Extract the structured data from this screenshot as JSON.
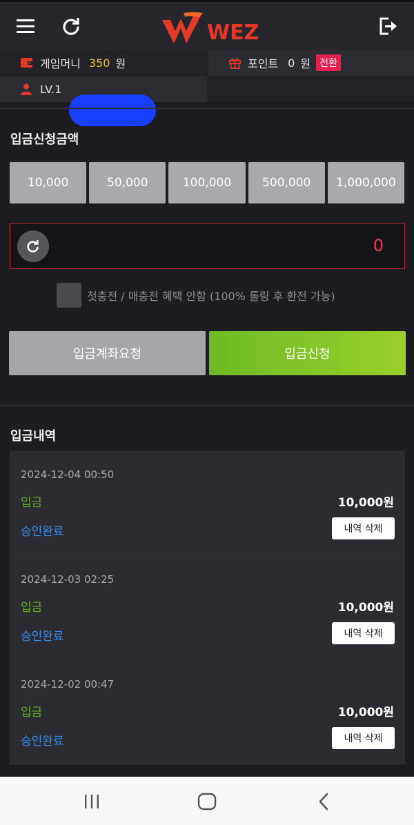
{
  "header": {
    "logo_text": "WEZ",
    "icons": [
      "menu-icon",
      "refresh-icon",
      "logout-icon"
    ]
  },
  "info": {
    "game_money_label": "게임머니",
    "game_money_value": "350",
    "game_money_unit": "원",
    "point_label": "포인트",
    "point_value": "0",
    "point_unit": "원",
    "convert_label": "전환",
    "level_label": "LV.1"
  },
  "deposit": {
    "section_title": "입금신청금액",
    "amounts": [
      "10,000",
      "50,000",
      "100,000",
      "500,000",
      "1,000,000"
    ],
    "amount_value": "0",
    "checkbox_label": "첫충전 / 매충전 혜택 안함 (100% 롤링 후 환전 가능)",
    "account_request_label": "입금계좌요청",
    "apply_label": "입금신청"
  },
  "history": {
    "section_title": "입금내역",
    "items": [
      {
        "date": "2024-12-04 00:50",
        "type": "입금",
        "amount": "10,000원",
        "status": "승인완료",
        "delete_label": "내역 삭제"
      },
      {
        "date": "2024-12-03 02:25",
        "type": "입금",
        "amount": "10,000원",
        "status": "승인완료",
        "delete_label": "내역 삭제"
      },
      {
        "date": "2024-12-02 00:47",
        "type": "입금",
        "amount": "10,000원",
        "status": "승인완료",
        "delete_label": "내역 삭제"
      }
    ]
  },
  "colors": {
    "accent_red": "#e8204f",
    "money_yellow": "#f1c232",
    "deposit_green": "#62a91f",
    "status_blue": "#2f8df0"
  }
}
